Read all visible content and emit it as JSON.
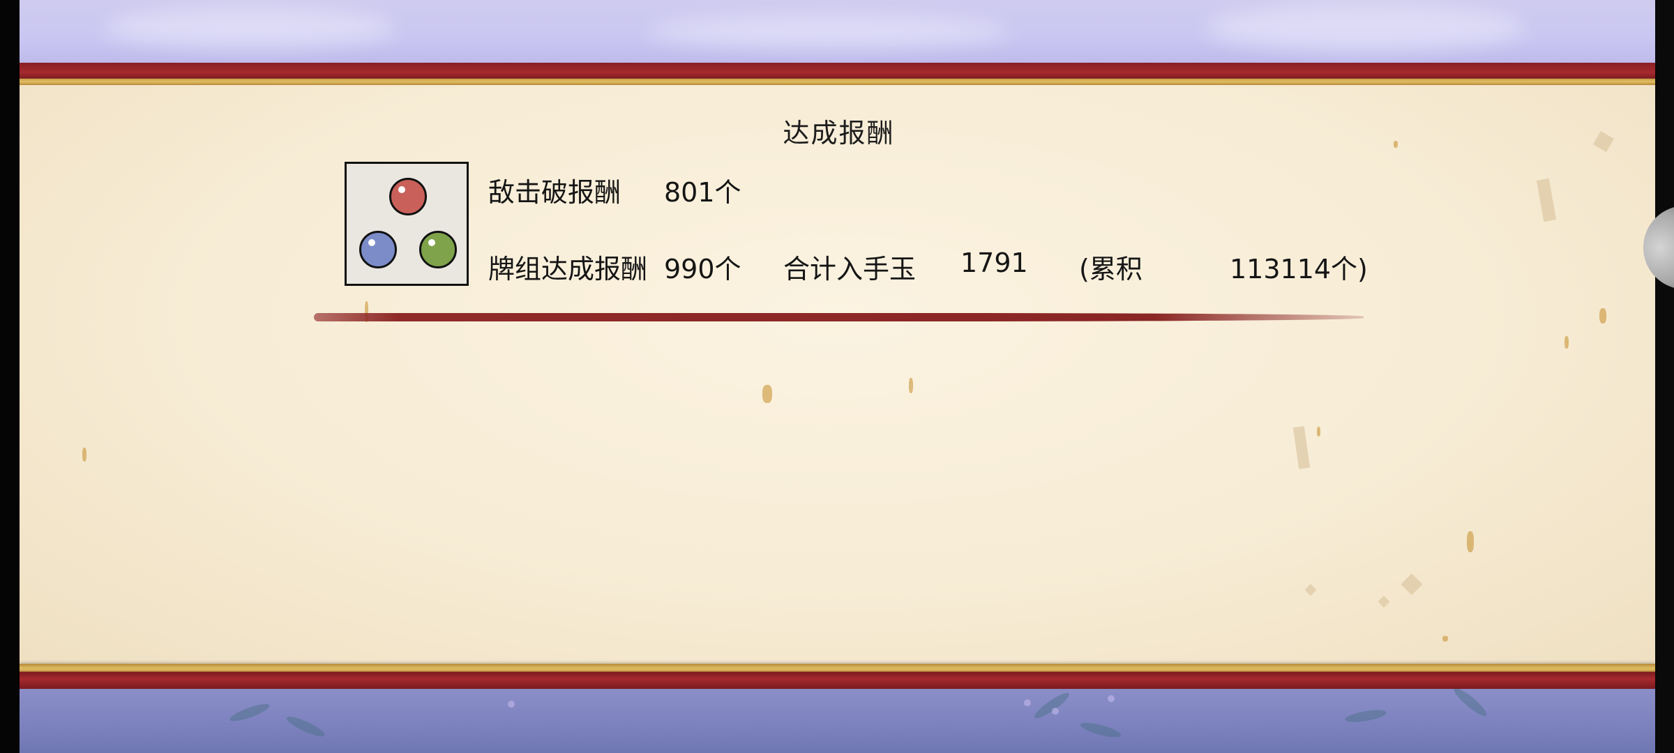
{
  "panel": {
    "title": "达成报酬"
  },
  "rewards": {
    "enemy_defeat_label": "敌击破报酬",
    "enemy_defeat_value": "801个",
    "deck_label": "牌组达成报酬",
    "deck_value": "990个",
    "total_label": "合计入手玉",
    "total_value": "1791",
    "cumulative_label": "(累积",
    "cumulative_value": "113114个)"
  },
  "icon": {
    "name": "three-orbs-icon",
    "orb_colors": [
      "#c9605a",
      "#7b8cc8",
      "#7fa34a"
    ]
  },
  "colors": {
    "frame_red": "#a52a2e",
    "frame_gold": "#e0bd62",
    "paper": "#f7ecd5",
    "sky": "#c9c6f2"
  }
}
